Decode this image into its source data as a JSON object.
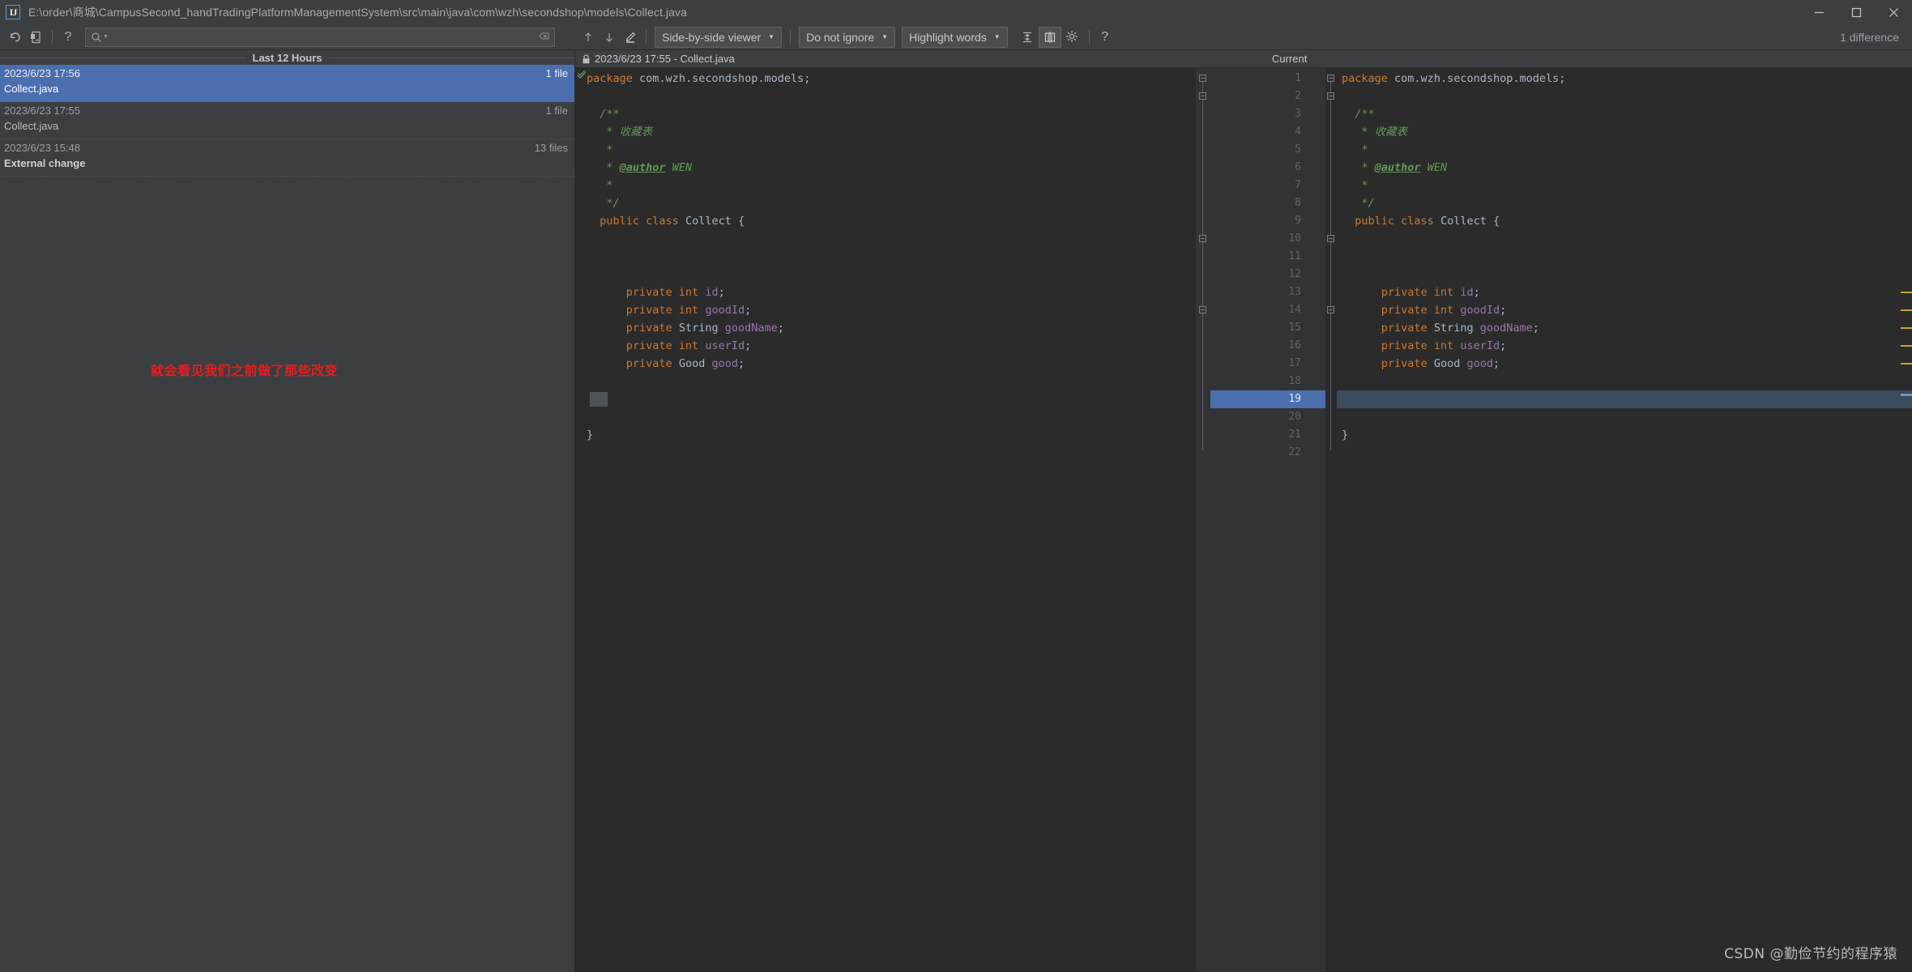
{
  "window": {
    "path": "E:\\order\\商城\\CampusSecond_handTradingPlatformManagementSystem\\src\\main\\java\\com\\wzh\\secondshop\\models\\Collect.java",
    "logo_text": "IJ",
    "minimize_label": "–",
    "maximize_label": "□",
    "close_label": "✕",
    "difference_count": "1 difference"
  },
  "toolbar": {
    "revert_icon": "undo-arrow-icon",
    "revert_label": "↶",
    "history_label": "⬒",
    "help_label": "?",
    "search_placeholder": "",
    "prev_diff_label": "↑",
    "next_diff_label": "↓",
    "edit_label": "✐",
    "viewer_mode": "Side-by-side viewer",
    "ignore_mode": "Do not ignore",
    "highlight_mode": "Highlight words",
    "collapse_label": "↕",
    "align_label": "⧉",
    "settings_label": "⚙",
    "help2_label": "?",
    "caret": "▾"
  },
  "changes": {
    "group_title": "Last 12 Hours",
    "rows": [
      {
        "date": "2023/6/23 17:56",
        "count": "1 file",
        "name": "Collect.java",
        "selected": true,
        "bold": false
      },
      {
        "date": "2023/6/23 17:55",
        "count": "1 file",
        "name": "Collect.java",
        "selected": false,
        "bold": false
      },
      {
        "date": "2023/6/23 15:48",
        "count": "13 files",
        "name": "External change",
        "selected": false,
        "bold": true
      }
    ],
    "annotation": "就会看见我们之前做了那些改变",
    "annotation_color": "#e81c1c"
  },
  "diff": {
    "left_title": "2023/6/23 17:55 - Collect.java",
    "right_title": "Current",
    "lock_icon": "lock-icon",
    "left_lines": [
      {
        "n": 1,
        "html": "<span class='kw'>package</span> <span class='pkg'>com.wzh.secondshop.models</span><span class='plain'>;</span>"
      },
      {
        "n": 2,
        "html": ""
      },
      {
        "n": 3,
        "html": "  <span class='doc'>/**</span>"
      },
      {
        "n": 4,
        "html": "   <span class='doc'>* 收藏表</span>"
      },
      {
        "n": 5,
        "html": "   <span class='doc'>*</span>"
      },
      {
        "n": 6,
        "html": "   <span class='doc'>* </span><span class='tag'>@author</span><span class='tagv'> WEN</span>"
      },
      {
        "n": 7,
        "html": "   <span class='doc'>*</span>"
      },
      {
        "n": 8,
        "html": "   <span class='doc'>*/</span>"
      },
      {
        "n": 9,
        "html": "  <span class='kw'>public class</span> <span class='type'>Collect</span> <span class='plain'>{</span>"
      },
      {
        "n": 10,
        "html": ""
      },
      {
        "n": 11,
        "html": ""
      },
      {
        "n": 12,
        "html": ""
      },
      {
        "n": 13,
        "html": "      <span class='kw'>private int</span> <span class='fld'>id</span><span class='plain'>;</span>"
      },
      {
        "n": 14,
        "html": "      <span class='kw'>private int</span> <span class='fld'>goodId</span><span class='plain'>;</span>"
      },
      {
        "n": 15,
        "html": "      <span class='kw'>private</span> <span class='type'>String</span> <span class='fld'>goodName</span><span class='plain'>;</span>"
      },
      {
        "n": 16,
        "html": "      <span class='kw'>private int</span> <span class='fld'>userId</span><span class='plain'>;</span>"
      },
      {
        "n": 17,
        "html": "      <span class='kw'>private</span> <span class='type'>Good</span> <span class='fld'>good</span><span class='plain'>;</span>"
      },
      {
        "n": 18,
        "html": ""
      },
      {
        "n": 19,
        "html": ""
      },
      {
        "n": 20,
        "html": ""
      },
      {
        "n": 21,
        "html": "<span class='plain'>}</span>"
      },
      {
        "n": 22,
        "html": ""
      }
    ],
    "right_lines": [
      {
        "n": 1,
        "html": "<span class='kw'>package</span> <span class='pkg'>com.wzh.secondshop.models</span><span class='plain'>;</span>"
      },
      {
        "n": 2,
        "html": ""
      },
      {
        "n": 3,
        "html": "  <span class='doc'>/**</span>"
      },
      {
        "n": 4,
        "html": "   <span class='doc'>* 收藏表</span>"
      },
      {
        "n": 5,
        "html": "   <span class='doc'>*</span>"
      },
      {
        "n": 6,
        "html": "   <span class='doc'>* </span><span class='tag'>@author</span><span class='tagv'> WEN</span>"
      },
      {
        "n": 7,
        "html": "   <span class='doc'>*</span>"
      },
      {
        "n": 8,
        "html": "   <span class='doc'>*/</span>"
      },
      {
        "n": 9,
        "html": "  <span class='kw'>public class</span> <span class='type'>Collect</span> <span class='plain'>{</span>"
      },
      {
        "n": 10,
        "html": ""
      },
      {
        "n": 11,
        "html": ""
      },
      {
        "n": 12,
        "html": ""
      },
      {
        "n": 13,
        "html": "      <span class='kw'>private int</span> <span class='fld'>id</span><span class='plain'>;</span>"
      },
      {
        "n": 14,
        "html": "      <span class='kw'>private int</span> <span class='fld'>goodId</span><span class='plain'>;</span>"
      },
      {
        "n": 15,
        "html": "      <span class='kw'>private</span> <span class='type'>String</span> <span class='fld'>goodName</span><span class='plain'>;</span>"
      },
      {
        "n": 16,
        "html": "      <span class='kw'>private int</span> <span class='fld'>userId</span><span class='plain'>;</span>"
      },
      {
        "n": 17,
        "html": "      <span class='kw'>private</span> <span class='type'>Good</span> <span class='fld'>good</span><span class='plain'>;</span>"
      },
      {
        "n": 18,
        "html": ""
      },
      {
        "n": 19,
        "html": ""
      },
      {
        "n": 20,
        "html": ""
      },
      {
        "n": 21,
        "html": "<span class='plain'>}</span>"
      },
      {
        "n": 22,
        "html": ""
      }
    ],
    "highlighted_line": 19,
    "marker_lines": [
      13,
      14,
      15,
      16,
      17
    ],
    "marker_color": "#c9a227",
    "highlight_color": "#3a4b5c"
  },
  "watermark": "CSDN @勤俭节约的程序猿"
}
